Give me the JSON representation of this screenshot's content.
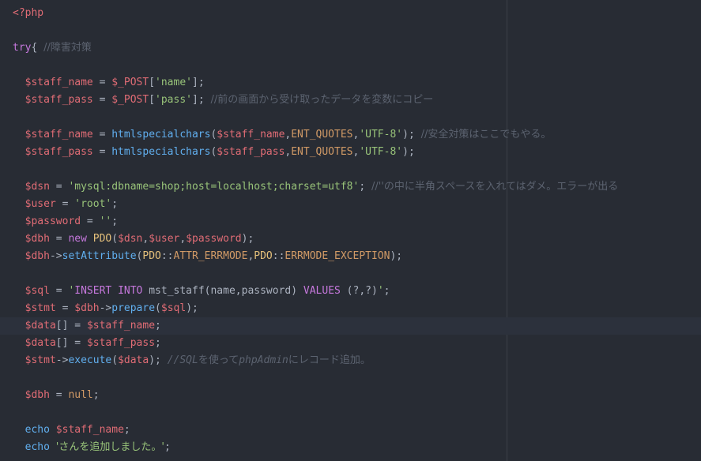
{
  "editor": {
    "language": "php",
    "theme_colors": {
      "background": "#282c34",
      "keyword": "#c678dd",
      "variable": "#e06c75",
      "function": "#61afef",
      "class": "#e5c07b",
      "string": "#98c379",
      "comment": "#5c6370",
      "constant": "#d19a66",
      "text": "#abb2bf"
    }
  },
  "code": {
    "l1": {
      "open_tag": "<?php"
    },
    "l3": {
      "kw": "try",
      "brace": "{ ",
      "comment": "//障害対策"
    },
    "l5": {
      "indent": "  ",
      "var": "$staff_name",
      "eq": " = ",
      "post": "$_POST",
      "open": "[",
      "key": "'name'",
      "close": "];"
    },
    "l6": {
      "indent": "  ",
      "var": "$staff_pass",
      "eq": " = ",
      "post": "$_POST",
      "open": "[",
      "key": "'pass'",
      "close": "]; ",
      "comment": "//前の画面から受け取ったデータを変数にコピー"
    },
    "l8": {
      "indent": "  ",
      "var": "$staff_name",
      "eq": " = ",
      "fn": "htmlspecialchars",
      "open": "(",
      "arg1": "$staff_name",
      "comma1": ",",
      "const": "ENT_QUOTES",
      "comma2": ",",
      "str": "'UTF-8'",
      "close": "); ",
      "comment": "//安全対策はここでもやる。"
    },
    "l9": {
      "indent": "  ",
      "var": "$staff_pass",
      "eq": " = ",
      "fn": "htmlspecialchars",
      "open": "(",
      "arg1": "$staff_pass",
      "comma1": ",",
      "const": "ENT_QUOTES",
      "comma2": ",",
      "str": "'UTF-8'",
      "close": ");"
    },
    "l11": {
      "indent": "  ",
      "var": "$dsn",
      "eq": " = ",
      "str": "'mysql:dbname=shop;host=localhost;charset=utf8'",
      "semi": "; ",
      "comment": "//''の中に半角スペースを入れてはダメ。エラーが出る"
    },
    "l12": {
      "indent": "  ",
      "var": "$user",
      "eq": " = ",
      "str": "'root'",
      "semi": ";"
    },
    "l13": {
      "indent": "  ",
      "var": "$password",
      "eq": " = ",
      "str": "''",
      "semi": ";"
    },
    "l14": {
      "indent": "  ",
      "var": "$dbh",
      "eq": " = ",
      "kw": "new",
      "sp": " ",
      "cls": "PDO",
      "open": "(",
      "a1": "$dsn",
      "c1": ",",
      "a2": "$user",
      "c2": ",",
      "a3": "$password",
      "close": ");"
    },
    "l15": {
      "indent": "  ",
      "var": "$dbh",
      "arrow": "->",
      "fn": "setAttribute",
      "open": "(",
      "cls1": "PDO",
      "dc1": "::",
      "const1": "ATTR_ERRMODE",
      "comma": ",",
      "cls2": "PDO",
      "dc2": "::",
      "const2": "ERRMODE_EXCEPTION",
      "close": ");"
    },
    "l17": {
      "indent": "  ",
      "var": "$sql",
      "eq": " = ",
      "q1": "'",
      "kw1": "INSERT",
      "sp1": " ",
      "kw2": "INTO",
      "mid": " mst_staff(name,password) ",
      "kw3": "VALUES",
      "tail": " (?,?)",
      "q2": "'",
      "semi": ";"
    },
    "l18": {
      "indent": "  ",
      "var": "$stmt",
      "eq": " = ",
      "var2": "$dbh",
      "arrow": "->",
      "fn": "prepare",
      "open": "(",
      "arg": "$sql",
      "close": ");"
    },
    "l19": {
      "indent": "  ",
      "var": "$data",
      "br": "[]",
      "eq": " = ",
      "var2": "$staff_name",
      "semi": ";"
    },
    "l20": {
      "indent": "  ",
      "var": "$data",
      "br": "[]",
      "eq": " = ",
      "var2": "$staff_pass",
      "semi": ";"
    },
    "l21": {
      "indent": "  ",
      "var": "$stmt",
      "arrow": "->",
      "fn": "execute",
      "open": "(",
      "arg": "$data",
      "close": "); ",
      "c1": "//SQL",
      "c2": "を使って",
      "c3": "phpAdmin",
      "c4": "にレコード追加。"
    },
    "l23": {
      "indent": "  ",
      "var": "$dbh",
      "eq": " = ",
      "kw": "null",
      "semi": ";"
    },
    "l25": {
      "indent": "  ",
      "kw": "echo",
      "sp": " ",
      "var": "$staff_name",
      "semi": ";"
    },
    "l26": {
      "indent": "  ",
      "kw": "echo",
      "sp": " ",
      "str": "'さんを追加しました。'",
      "semi": ";"
    }
  }
}
